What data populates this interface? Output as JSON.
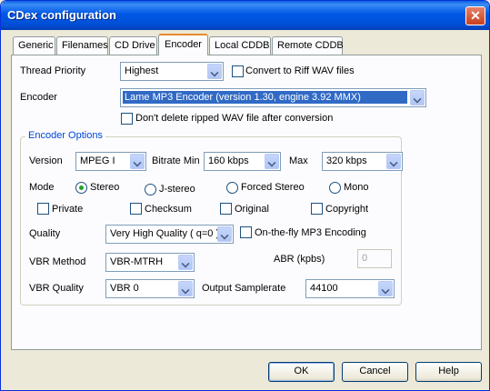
{
  "window": {
    "title": "CDex configuration"
  },
  "tabs": [
    {
      "label": "Generic"
    },
    {
      "label": "Filenames"
    },
    {
      "label": "CD Drive"
    },
    {
      "label": "Encoder",
      "active": true
    },
    {
      "label": "Local CDDB"
    },
    {
      "label": "Remote CDDB"
    }
  ],
  "general": {
    "thread_priority_label": "Thread Priority",
    "thread_priority_value": "Highest",
    "convert_riff_label": "Convert to Riff WAV files",
    "encoder_label": "Encoder",
    "encoder_value": "Lame MP3 Encoder (version 1.30, engine 3.92 MMX)",
    "dont_delete_label": "Don't delete ripped WAV file after conversion"
  },
  "encoder_options": {
    "group_title": "Encoder Options",
    "version_label": "Version",
    "version_value": "MPEG I",
    "bitrate_min_label": "Bitrate Min",
    "bitrate_min_value": "160 kbps",
    "max_label": "Max",
    "max_value": "320 kbps",
    "mode_label": "Mode",
    "modes": [
      {
        "label": "Stereo",
        "selected": true
      },
      {
        "label": "J-stereo",
        "selected": false
      },
      {
        "label": "Forced Stereo",
        "selected": false
      },
      {
        "label": "Mono",
        "selected": false
      }
    ],
    "flags": [
      {
        "label": "Private",
        "checked": false
      },
      {
        "label": "Checksum",
        "checked": false
      },
      {
        "label": "Original",
        "checked": false
      },
      {
        "label": "Copyright",
        "checked": false
      }
    ],
    "quality_label": "Quality",
    "quality_value": "Very High Quality ( q=0 )",
    "onthefly_label": "On-the-fly MP3 Encoding",
    "vbr_method_label": "VBR Method",
    "vbr_method_value": "VBR-MTRH",
    "abr_label": "ABR (kpbs)",
    "abr_value": "0",
    "vbr_quality_label": "VBR Quality",
    "vbr_quality_value": "VBR 0",
    "output_samplerate_label": "Output Samplerate",
    "output_samplerate_value": "44100"
  },
  "buttons": {
    "ok": "OK",
    "cancel": "Cancel",
    "help": "Help"
  },
  "colors": {
    "titlebar": "#0058e6",
    "dialog_bg": "#ece9d8",
    "selection": "#316ac5",
    "active_tab_accent": "#e68b2c"
  }
}
